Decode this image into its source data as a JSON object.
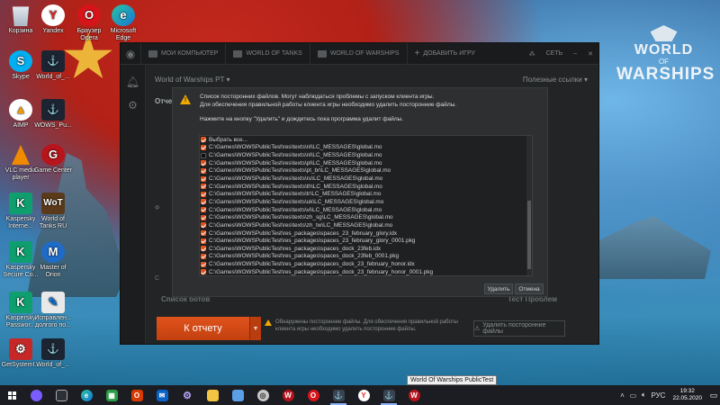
{
  "desktop": {
    "icons": [
      {
        "name": "recycle-bin",
        "label": "Корзина",
        "glyph": "",
        "style": "ico-bin"
      },
      {
        "name": "yandex",
        "label": "Yandex",
        "glyph": "Y",
        "style": "ico-yandex"
      },
      {
        "name": "opera",
        "label": "Браузер Opera",
        "glyph": "O",
        "style": "ico-opera"
      },
      {
        "name": "edge",
        "label": "Microsoft Edge",
        "glyph": "e",
        "style": "ico-edge"
      },
      {
        "name": "skype",
        "label": "Skype",
        "glyph": "S",
        "style": "ico-skype"
      },
      {
        "name": "wows-1",
        "label": "World_of_...",
        "glyph": "⚓",
        "style": "ico-wows"
      },
      {
        "name": "aimp",
        "label": "AIMP",
        "glyph": "▲",
        "style": "ico-aimp"
      },
      {
        "name": "wows-pt",
        "label": "WOWS_Pu...",
        "glyph": "⚓",
        "style": "ico-wows"
      },
      {
        "name": "vlc",
        "label": "VLC media player",
        "glyph": "",
        "style": "ico-vlc"
      },
      {
        "name": "game-center",
        "label": "Game Center",
        "glyph": "G",
        "style": "ico-gc"
      },
      {
        "name": "kaspersky-internet",
        "label": "Kaspersky Interne...",
        "glyph": "K",
        "style": "ico-kas"
      },
      {
        "name": "world-of-tanks",
        "label": "World of Tanks RU",
        "glyph": "WoT",
        "style": "ico-wot"
      },
      {
        "name": "kaspersky-secure",
        "label": "Kaspersky Secure Co...",
        "glyph": "K",
        "style": "ico-kas"
      },
      {
        "name": "master-of-orion",
        "label": "Master of Orion",
        "glyph": "M",
        "style": "ico-moo"
      },
      {
        "name": "kaspersky-password",
        "label": "Kaspersky Passwor...",
        "glyph": "K",
        "style": "ico-kas"
      },
      {
        "name": "fix-tool",
        "label": "Исправлен... долгого по...",
        "glyph": "✎",
        "style": "ico-fix"
      },
      {
        "name": "getsystem",
        "label": "GetSystemI...",
        "glyph": "⚙",
        "style": "ico-getsys"
      },
      {
        "name": "wows-2",
        "label": "World_of_...",
        "glyph": "⚓",
        "style": "ico-wows"
      }
    ],
    "logo": {
      "line1": "WORLD",
      "line2": "OF",
      "line3": "WARSHIPS"
    }
  },
  "launcher": {
    "tabs": [
      "МОИ КОМПЬЮТЕР",
      "WORLD OF TANKS",
      "WORLD OF WARSHIPS",
      "ДОБАВИТЬ ИГРУ"
    ],
    "network_label": "СЕТЬ",
    "game_select": "World of Warships PT",
    "useful_links": "Полезные ссылки",
    "report_title": "Отчет",
    "row_a": "Ф",
    "row_b": "С",
    "bottom_left_name": "Список ботов",
    "bottom_right_name": "Тест Проблем",
    "report_button": "К отчету",
    "warning_text": "Обнаружены посторонние файлы. Для обеспечения правильной работы клиента игры необходимо удалить посторонние файлы.",
    "delete_files_button": "Удалить посторонние файлы"
  },
  "dialog": {
    "message_line1": "Список посторонних файлов. Могут наблюдаться проблемы с запуском клиента игры.",
    "message_line2": "Для обеспечения правильной работы клиента игры необходимо удалить посторонние файлы.",
    "message_line3": "Нажмите на кнопку \"Удалить\" и дождитесь пока программа удалит файлы.",
    "select_all": "Выбрать все...",
    "files": [
      {
        "path": "C:\\Games\\WOWSPublicTest\\res\\texts\\nl\\LC_MESSAGES\\global.mo",
        "checked": true
      },
      {
        "path": "C:\\Games\\WOWSPublicTest\\res\\texts\\nl\\LC_MESSAGES\\global.mo",
        "checked": false
      },
      {
        "path": "C:\\Games\\WOWSPublicTest\\res\\texts\\pl\\LC_MESSAGES\\global.mo",
        "checked": true
      },
      {
        "path": "C:\\Games\\WOWSPublicTest\\res\\texts\\pt_br\\LC_MESSAGES\\global.mo",
        "checked": true
      },
      {
        "path": "C:\\Games\\WOWSPublicTest\\res\\texts\\ru\\LC_MESSAGES\\global.mo",
        "checked": true
      },
      {
        "path": "C:\\Games\\WOWSPublicTest\\res\\texts\\th\\LC_MESSAGES\\global.mo",
        "checked": true
      },
      {
        "path": "C:\\Games\\WOWSPublicTest\\res\\texts\\tr\\LC_MESSAGES\\global.mo",
        "checked": true
      },
      {
        "path": "C:\\Games\\WOWSPublicTest\\res\\texts\\uk\\LC_MESSAGES\\global.mo",
        "checked": true
      },
      {
        "path": "C:\\Games\\WOWSPublicTest\\res\\texts\\vi\\LC_MESSAGES\\global.mo",
        "checked": true
      },
      {
        "path": "C:\\Games\\WOWSPublicTest\\res\\texts\\zh_sg\\LC_MESSAGES\\global.mo",
        "checked": true
      },
      {
        "path": "C:\\Games\\WOWSPublicTest\\res\\texts\\zh_tw\\LC_MESSAGES\\global.mo",
        "checked": true
      },
      {
        "path": "C:\\Games\\WOWSPublicTest\\res_packages\\spaces_23_february_glory.idx",
        "checked": true
      },
      {
        "path": "C:\\Games\\WOWSPublicTest\\res_packages\\spaces_23_february_glory_0001.pkg",
        "checked": true
      },
      {
        "path": "C:\\Games\\WOWSPublicTest\\res_packages\\spaces_dock_23feb.idx",
        "checked": true
      },
      {
        "path": "C:\\Games\\WOWSPublicTest\\res_packages\\spaces_dock_23feb_0001.pkg",
        "checked": true
      },
      {
        "path": "C:\\Games\\WOWSPublicTest\\res_packages\\spaces_dock_23_february_honor.idx",
        "checked": true
      },
      {
        "path": "C:\\Games\\WOWSPublicTest\\res_packages\\spaces_dock_23_february_honor_0001.pkg",
        "checked": true
      }
    ],
    "delete_button": "Удалить",
    "cancel_button": "Отмена"
  },
  "taskbar": {
    "search_hint": "Windows",
    "tooltip": "World Of Warships PublicTest",
    "language": "РУС",
    "time": "19:32",
    "date": "22.05.2020"
  }
}
